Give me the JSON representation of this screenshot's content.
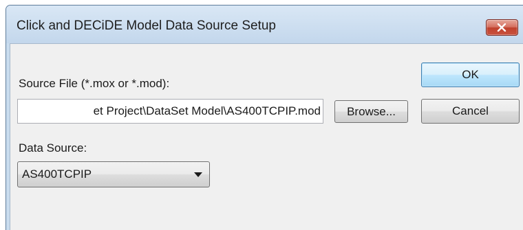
{
  "window": {
    "title": "Click and DECiDE Model Data Source Setup",
    "close_icon": "close-x-icon"
  },
  "source_file": {
    "label": "Source File (*.mox or *.mod):",
    "value": "et Project\\DataSet Model\\AS400TCPIP.mod",
    "browse_label": "Browse..."
  },
  "buttons": {
    "ok_label": "OK",
    "cancel_label": "Cancel"
  },
  "data_source": {
    "label": "Data Source:",
    "selected": "AS400TCPIP"
  },
  "colors": {
    "titlebar": "#c9dcee",
    "client": "#f0f0f0",
    "close_button": "#c9533f",
    "default_button_border": "#3c7fb1"
  }
}
